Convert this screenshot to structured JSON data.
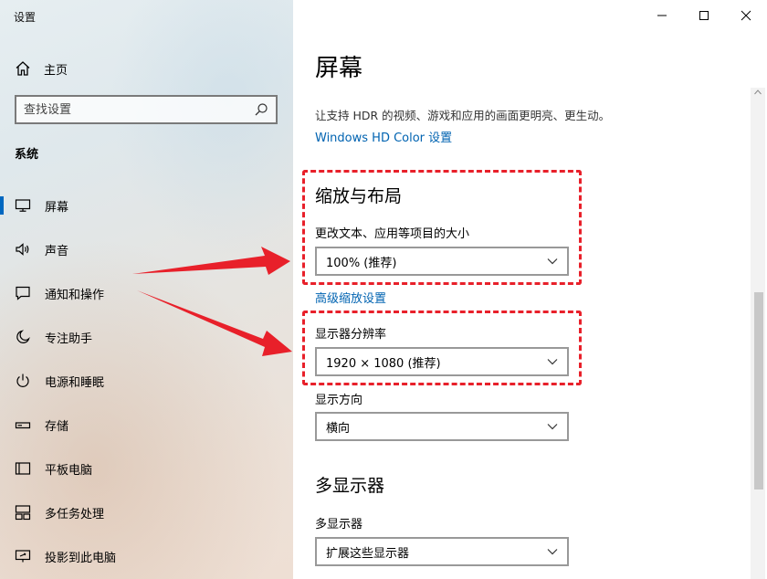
{
  "window": {
    "title": "设置"
  },
  "sidebar": {
    "home_label": "主页",
    "search_placeholder": "查找设置",
    "section_title": "系统",
    "items": [
      {
        "label": "屏幕",
        "icon": "monitor-icon",
        "active": true
      },
      {
        "label": "声音",
        "icon": "speaker-icon"
      },
      {
        "label": "通知和操作",
        "icon": "notification-icon"
      },
      {
        "label": "专注助手",
        "icon": "moon-icon"
      },
      {
        "label": "电源和睡眠",
        "icon": "power-icon"
      },
      {
        "label": "存储",
        "icon": "storage-icon"
      },
      {
        "label": "平板电脑",
        "icon": "tablet-icon"
      },
      {
        "label": "多任务处理",
        "icon": "multitask-icon"
      },
      {
        "label": "投影到此电脑",
        "icon": "projection-icon"
      }
    ]
  },
  "main": {
    "title": "屏幕",
    "hdr_description": "让支持 HDR 的视频、游戏和应用的画面更明亮、更生动。",
    "hdr_link": "Windows HD Color 设置",
    "scale_layout": {
      "heading": "缩放与布局",
      "text_size_label": "更改文本、应用等项目的大小",
      "text_size_value": "100% (推荐)",
      "advanced_link": "高级缩放设置",
      "resolution_label": "显示器分辨率",
      "resolution_value": "1920 × 1080 (推荐)",
      "orientation_label": "显示方向",
      "orientation_value": "横向"
    },
    "multi_display": {
      "heading": "多显示器",
      "label": "多显示器",
      "value": "扩展这些显示器"
    }
  },
  "colors": {
    "accent": "#0067c0",
    "link": "#0063b1",
    "annotation": "#e8202a"
  }
}
